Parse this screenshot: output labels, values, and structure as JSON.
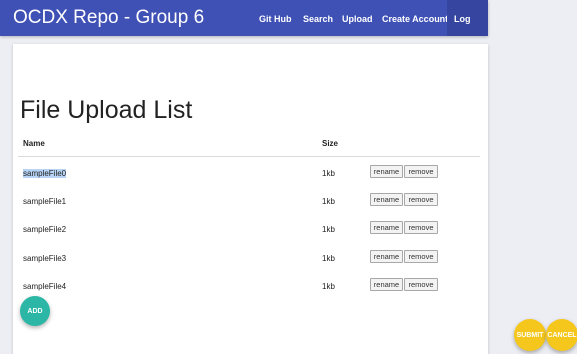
{
  "navbar": {
    "brand": "OCDX Repo - Group 6",
    "links": [
      "Git Hub",
      "Search",
      "Upload",
      "Create Account",
      "Log out"
    ]
  },
  "main": {
    "title": "File Upload List",
    "columns": {
      "name": "Name",
      "size": "Size"
    },
    "rows": [
      {
        "name": "sampleFile0",
        "size": "1kb",
        "selected": true
      },
      {
        "name": "sampleFile1",
        "size": "1kb"
      },
      {
        "name": "sampleFile2",
        "size": "1kb"
      },
      {
        "name": "sampleFile3",
        "size": "1kb"
      },
      {
        "name": "sampleFile4",
        "size": "1kb"
      }
    ],
    "row_actions": {
      "rename": "rename",
      "remove": "remove"
    },
    "add_label": "ADD"
  },
  "actions": {
    "submit": "SUBMIT",
    "cancel": "CANCEL"
  },
  "colors": {
    "navbar": "#3f51b5",
    "add_button": "#2bb6a5",
    "action_buttons": "#f5c71d",
    "selection": "#b7d3f5"
  }
}
